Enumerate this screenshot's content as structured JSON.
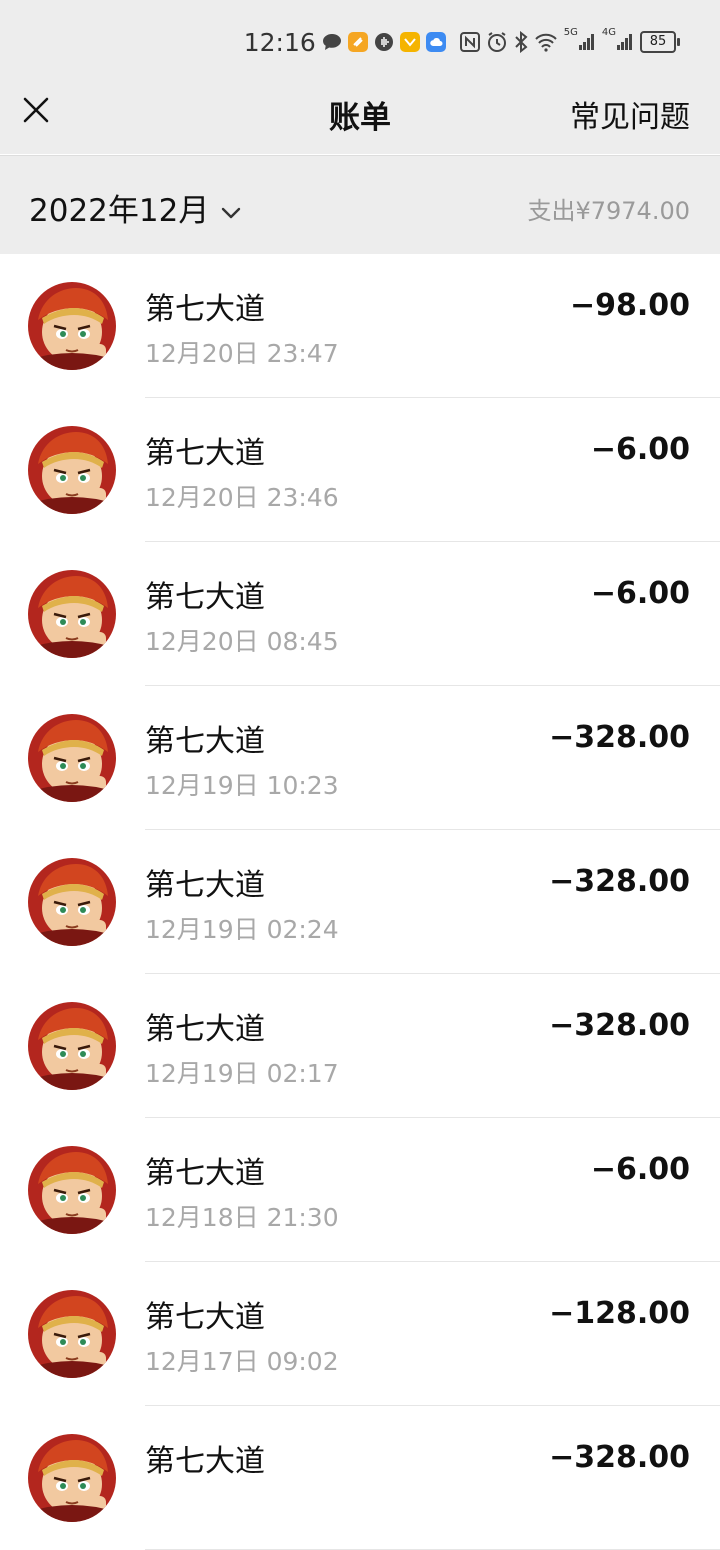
{
  "status": {
    "time": "12:16",
    "net_5g": "5G",
    "net_4g": "4G",
    "battery": "85"
  },
  "nav": {
    "title": "账单",
    "faq": "常见问题"
  },
  "month": {
    "label": "2022年12月",
    "spend": "支出¥7974.00"
  },
  "transactions": [
    {
      "name": "第七大道",
      "time": "12月20日 23:47",
      "amount": "−98.00"
    },
    {
      "name": "第七大道",
      "time": "12月20日 23:46",
      "amount": "−6.00"
    },
    {
      "name": "第七大道",
      "time": "12月20日 08:45",
      "amount": "−6.00"
    },
    {
      "name": "第七大道",
      "time": "12月19日 10:23",
      "amount": "−328.00"
    },
    {
      "name": "第七大道",
      "time": "12月19日 02:24",
      "amount": "−328.00"
    },
    {
      "name": "第七大道",
      "time": "12月19日 02:17",
      "amount": "−328.00"
    },
    {
      "name": "第七大道",
      "time": "12月18日 21:30",
      "amount": "−6.00"
    },
    {
      "name": "第七大道",
      "time": "12月17日 09:02",
      "amount": "−128.00"
    },
    {
      "name": "第七大道",
      "time": "",
      "amount": "−328.00"
    }
  ]
}
